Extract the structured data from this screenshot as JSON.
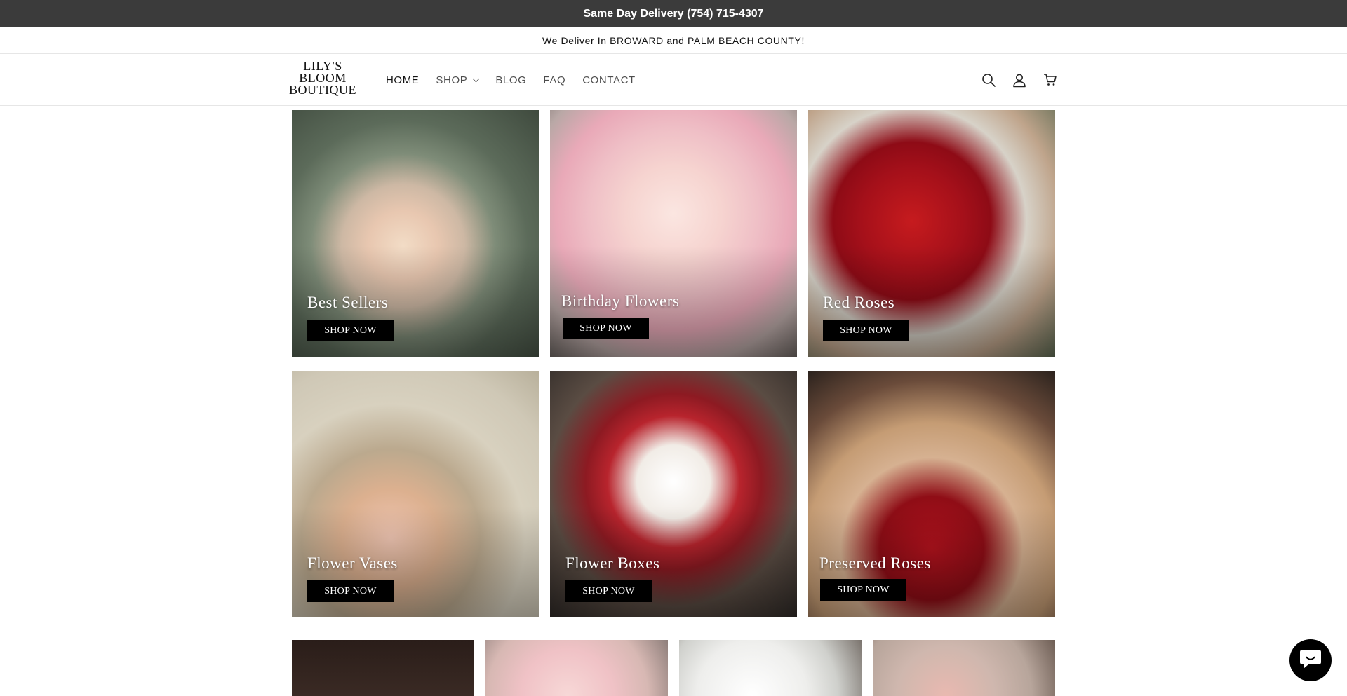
{
  "announcement": {
    "text": "Same Day Delivery (754) 715-4307"
  },
  "subbanner": {
    "text": "We Deliver In BROWARD and PALM BEACH COUNTY!"
  },
  "header": {
    "logo_lines": [
      "LILY'S",
      "BLOOM",
      "BOUTIQUE"
    ],
    "nav": [
      {
        "label": "HOME",
        "active": true
      },
      {
        "label": "SHOP",
        "has_dropdown": true
      },
      {
        "label": "BLOG"
      },
      {
        "label": "FAQ"
      },
      {
        "label": "CONTACT"
      }
    ],
    "icons": [
      "search-icon",
      "account-icon",
      "cart-icon"
    ]
  },
  "collections": [
    {
      "title": "Best Sellers",
      "button": "SHOP NOW"
    },
    {
      "title": "Birthday Flowers",
      "button": "SHOP NOW"
    },
    {
      "title": "Red Roses",
      "button": "SHOP NOW"
    },
    {
      "title": "Flower Vases",
      "button": "SHOP NOW"
    },
    {
      "title": "Flower Boxes",
      "button": "SHOP NOW"
    },
    {
      "title": "Preserved Roses",
      "button": "SHOP NOW"
    }
  ],
  "chat": {
    "icon": "chat-icon",
    "color": "#000000"
  },
  "colors": {
    "topbar": "#3b3b3b",
    "button": "#000000"
  }
}
